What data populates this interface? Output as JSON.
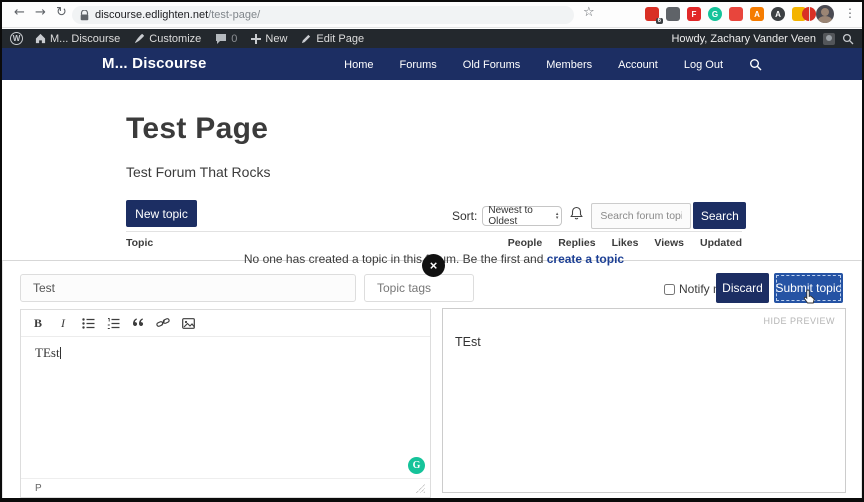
{
  "browser": {
    "url_domain": "discourse.edlighten.net",
    "url_path": "test-page/",
    "back": "←",
    "forward": "→",
    "reload": "↻",
    "star": "☆",
    "kebab": "⋮",
    "extensions": [
      {
        "name": "ext-red-badge",
        "color": "#d93025",
        "shape": "square",
        "letter": "",
        "badge": "6"
      },
      {
        "name": "ext-gray",
        "color": "#5f6368",
        "shape": "square",
        "letter": ""
      },
      {
        "name": "ext-flipboard",
        "color": "#e12828",
        "shape": "square",
        "letter": "F"
      },
      {
        "name": "ext-grammarly",
        "color": "#15c39a",
        "shape": "circle",
        "letter": "G"
      },
      {
        "name": "ext-red-tag",
        "color": "#e8453c",
        "shape": "square",
        "letter": ""
      },
      {
        "name": "ext-orange",
        "color": "#f57c00",
        "shape": "square",
        "letter": "A"
      },
      {
        "name": "ext-dark-circle",
        "color": "#3c4043",
        "shape": "circle",
        "letter": "A"
      },
      {
        "name": "ext-yellow",
        "color": "#f4b400",
        "shape": "square",
        "letter": ""
      },
      {
        "name": "ext-red-circle",
        "color": "#d93025",
        "shape": "circle",
        "letter": ""
      }
    ]
  },
  "admin_bar": {
    "wp": "W",
    "site_name": "M... Discourse",
    "customize_label": "Customize",
    "comments_count": "0",
    "new_label": "New",
    "edit_page_label": "Edit Page",
    "howdy": "Howdy, Zachary Vander Veen"
  },
  "navbar": {
    "logo": "M... Discourse",
    "items": [
      "Home",
      "Forums",
      "Old Forums",
      "Members",
      "Account",
      "Log Out"
    ]
  },
  "page": {
    "title": "Test Page",
    "subtitle": "Test Forum That Rocks"
  },
  "forum_toolbar": {
    "new_topic_label": "New topic",
    "sort_label": "Sort:",
    "sort_value": "Newest to Oldest",
    "sort_arrow_up": "▴",
    "sort_arrow_down": "▾",
    "search_placeholder": "Search forum topics",
    "search_label": "Search"
  },
  "topics_table": {
    "topic_col": "Topic",
    "right_cols": [
      "People",
      "Replies",
      "Likes",
      "Views",
      "Updated"
    ],
    "empty_prefix": "No one has created a topic in this forum. Be the first and ",
    "empty_link": "create a topic"
  },
  "composer": {
    "close_glyph": "×",
    "title_value": "Test",
    "tags_placeholder": "Topic tags",
    "notify_label": "Notify me",
    "discard_label": "Discard",
    "submit_label": "Submit topic",
    "toolbar": {
      "bold": "B",
      "italic": "I"
    },
    "editor_text": "TEst",
    "status_left": "P",
    "grammarly_letter": "G",
    "hide_preview_label": "HIDE PREVIEW",
    "preview_text": "TEst"
  },
  "colors": {
    "navy": "#1c2e63",
    "submit_blue": "#2553a4",
    "admin_bar_bg": "#23282d",
    "grammarly_green": "#15c39a",
    "link_blue": "#1c3f94"
  }
}
